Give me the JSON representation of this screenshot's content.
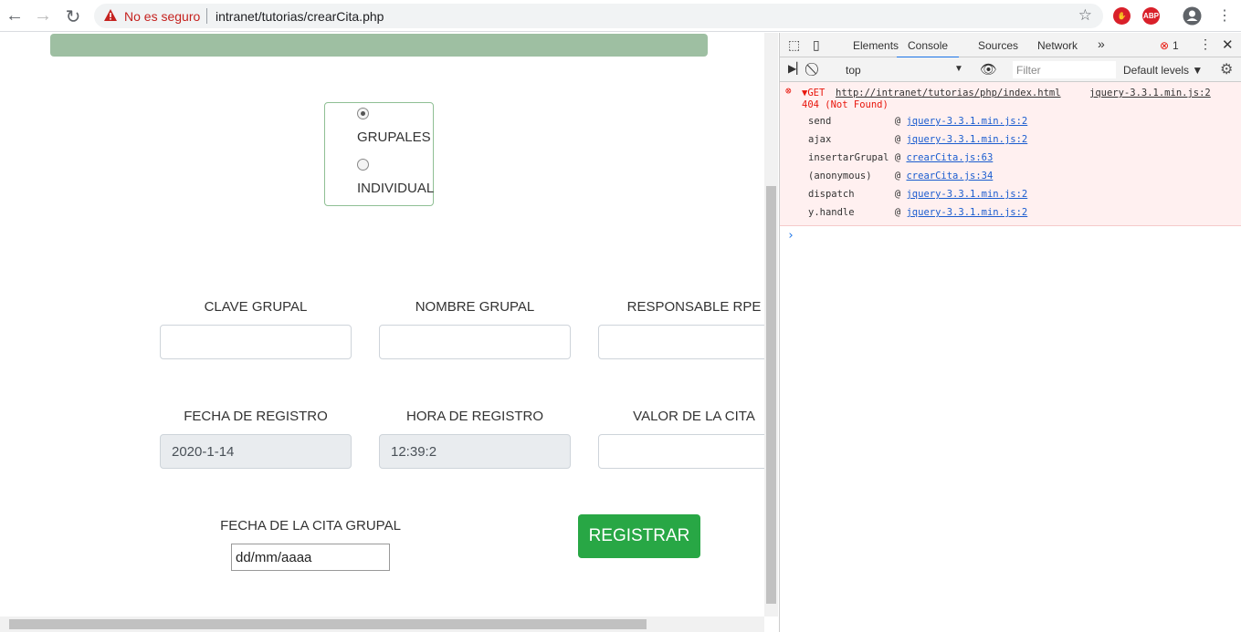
{
  "browser": {
    "insecure_label": "No es seguro",
    "url": "intranet/tutorias/crearCita.php",
    "ext_abp": "ABP"
  },
  "form": {
    "options": [
      {
        "label": "GRUPALES",
        "checked": true
      },
      {
        "label": "INDIVIDUAL",
        "checked": false
      }
    ],
    "fields": [
      {
        "label": "CLAVE GRUPAL",
        "value": ""
      },
      {
        "label": "NOMBRE GRUPAL",
        "value": ""
      },
      {
        "label": "RESPONSABLE RPE",
        "value": ""
      },
      {
        "label": "FECHA DE REGISTRO",
        "value": "2020-1-14",
        "readonly": true
      },
      {
        "label": "HORA DE REGISTRO",
        "value": "12:39:2",
        "readonly": true
      },
      {
        "label": "VALOR DE LA CITA",
        "value": ""
      }
    ],
    "date_label": "FECHA DE LA CITA GRUPAL",
    "date_placeholder": "dd/mm/aaaa",
    "submit": "REGISTRAR"
  },
  "devtools": {
    "tabs": [
      "Elements",
      "Console",
      "Sources",
      "Network"
    ],
    "more": "»",
    "active_tab": "Console",
    "error_count": "1",
    "context": "top",
    "filter_placeholder": "Filter",
    "levels": "Default levels ▼",
    "error": {
      "method": "▼GET",
      "url": "http://intranet/tutorias/php/index.html",
      "source": "jquery-3.3.1.min.js:2",
      "status": "404 (Not Found)",
      "frames": [
        {
          "fn": "send          ",
          "src": "jquery-3.3.1.min.js:2"
        },
        {
          "fn": "ajax          ",
          "src": "jquery-3.3.1.min.js:2"
        },
        {
          "fn": "insertarGrupal",
          "src": "crearCita.js:63"
        },
        {
          "fn": "(anonymous)   ",
          "src": "crearCita.js:34"
        },
        {
          "fn": "dispatch      ",
          "src": "jquery-3.3.1.min.js:2"
        },
        {
          "fn": "y.handle      ",
          "src": "jquery-3.3.1.min.js:2"
        }
      ]
    },
    "prompt": "›"
  }
}
